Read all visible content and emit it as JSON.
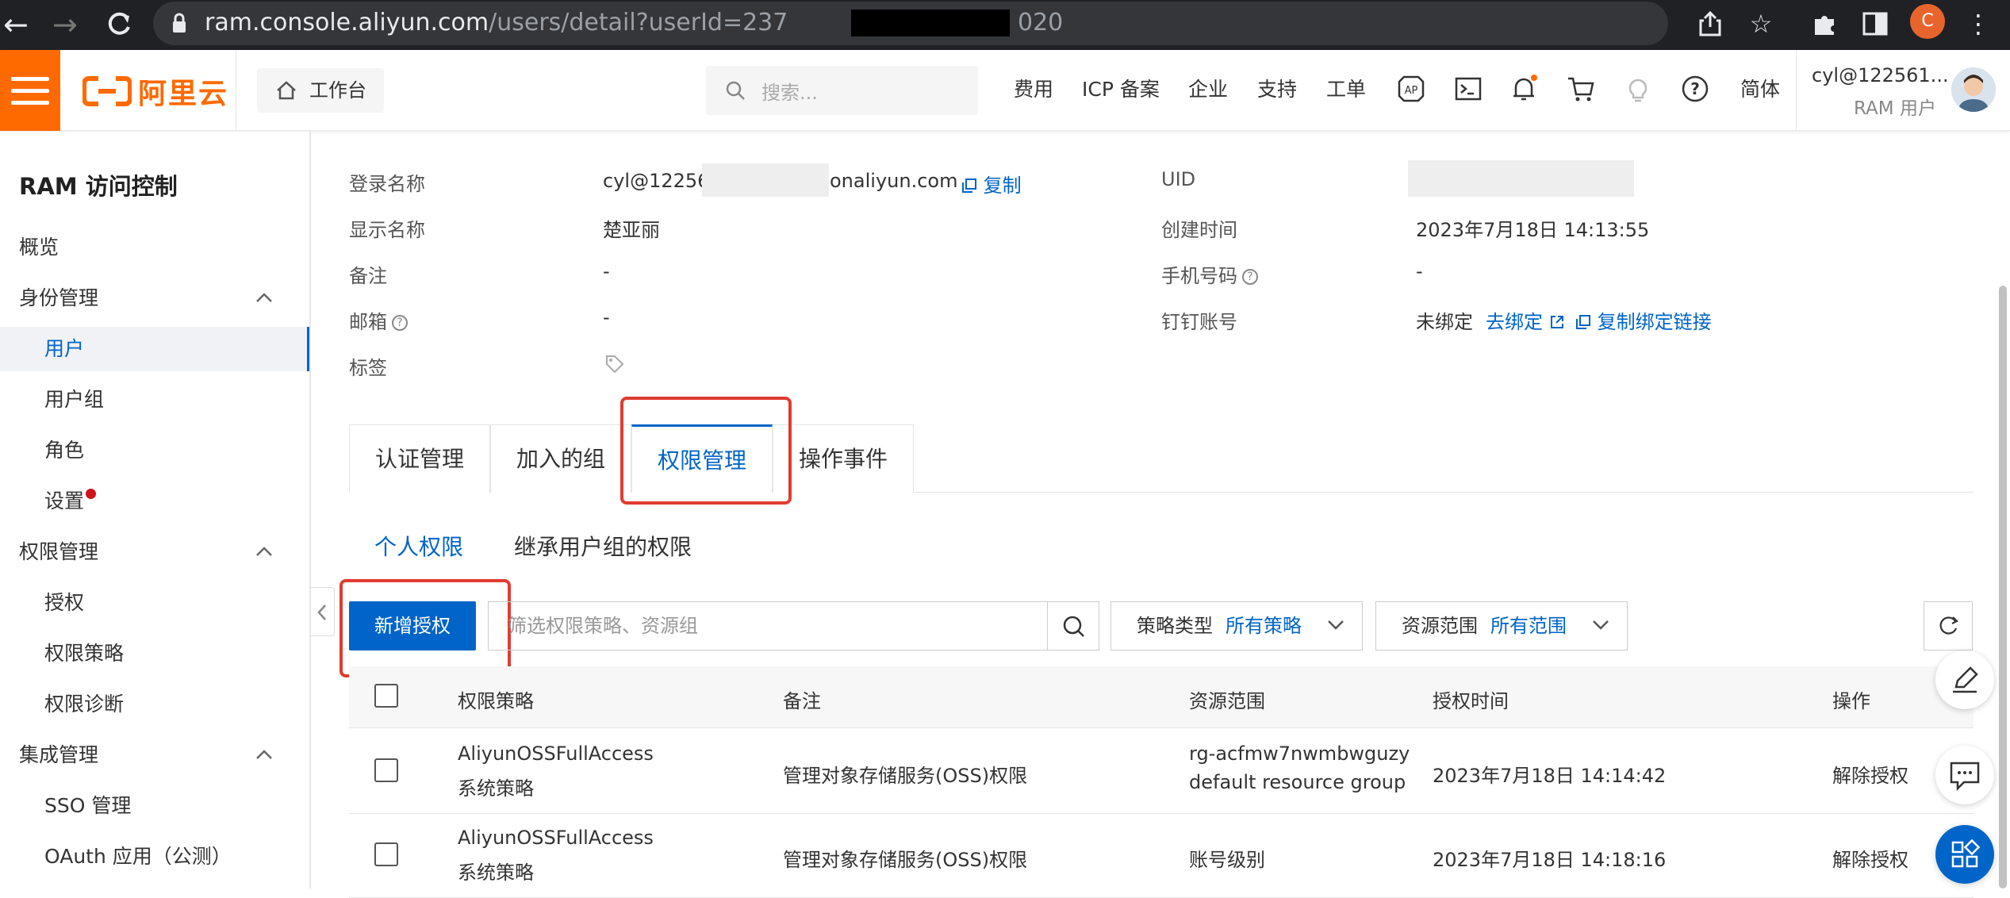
{
  "browser": {
    "url_host": "ram.console.aliyun.com",
    "url_path": "/users/detail?userId=237",
    "url_tail": "020",
    "profile_initial": "C"
  },
  "topbar": {
    "logo_text": "阿里云",
    "workbench": "工作台",
    "search_placeholder": "搜索...",
    "nav": [
      "费用",
      "ICP 备案",
      "企业",
      "支持",
      "工单"
    ],
    "lang": "简体",
    "user_name": "cyl@122561...",
    "user_role": "RAM 用户",
    "accent": "#ff6a00"
  },
  "sidebar": {
    "title": "RAM 访问控制",
    "overview": "概览",
    "identity": "身份管理",
    "users": "用户",
    "user_groups": "用户组",
    "roles": "角色",
    "settings": "设置",
    "permissions": "权限管理",
    "grant": "授权",
    "policies": "权限策略",
    "diagnosis": "权限诊断",
    "integration": "集成管理",
    "sso": "SSO 管理",
    "oauth": "OAuth 应用（公测）"
  },
  "info": {
    "login_label": "登录名称",
    "login_prefix": "cyl@12256",
    "login_suffix": "onaliyun.com",
    "copy": "复制",
    "display_label": "显示名称",
    "display_value": "楚亚丽",
    "remark_label": "备注",
    "remark_value": "-",
    "email_label": "邮箱",
    "email_value": "-",
    "tag_label": "标签",
    "uid_label": "UID",
    "created_label": "创建时间",
    "created_value": "2023年7月18日 14:13:55",
    "phone_label": "手机号码",
    "phone_value": "-",
    "dingtalk_label": "钉钉账号",
    "dingtalk_value": "未绑定",
    "bind_link": "去绑定",
    "copy_bind_link": "复制绑定链接"
  },
  "tabs": [
    "认证管理",
    "加入的组",
    "权限管理",
    "操作事件"
  ],
  "subtabs": [
    "个人权限",
    "继承用户组的权限"
  ],
  "toolbar": {
    "add_button": "新增授权",
    "filter_placeholder": "筛选权限策略、资源组",
    "policy_type_label": "策略类型",
    "policy_type_value": "所有策略",
    "scope_label": "资源范围",
    "scope_value": "所有范围"
  },
  "table": {
    "headers": [
      "权限策略",
      "备注",
      "资源范围",
      "授权时间",
      "操作"
    ],
    "rows": [
      {
        "policy": "AliyunOSSFullAccess",
        "policy_type": "系统策略",
        "remark": "管理对象存储服务(OSS)权限",
        "scope": "rg-acfmw7nwmbwguzy",
        "scope_sub": "default resource group",
        "time": "2023年7月18日 14:14:42",
        "action": "解除授权"
      },
      {
        "policy": "AliyunOSSFullAccess",
        "policy_type": "系统策略",
        "remark": "管理对象存储服务(OSS)权限",
        "scope": "账号级别",
        "scope_sub": "",
        "time": "2023年7月18日 14:18:16",
        "action": "解除授权"
      }
    ]
  }
}
